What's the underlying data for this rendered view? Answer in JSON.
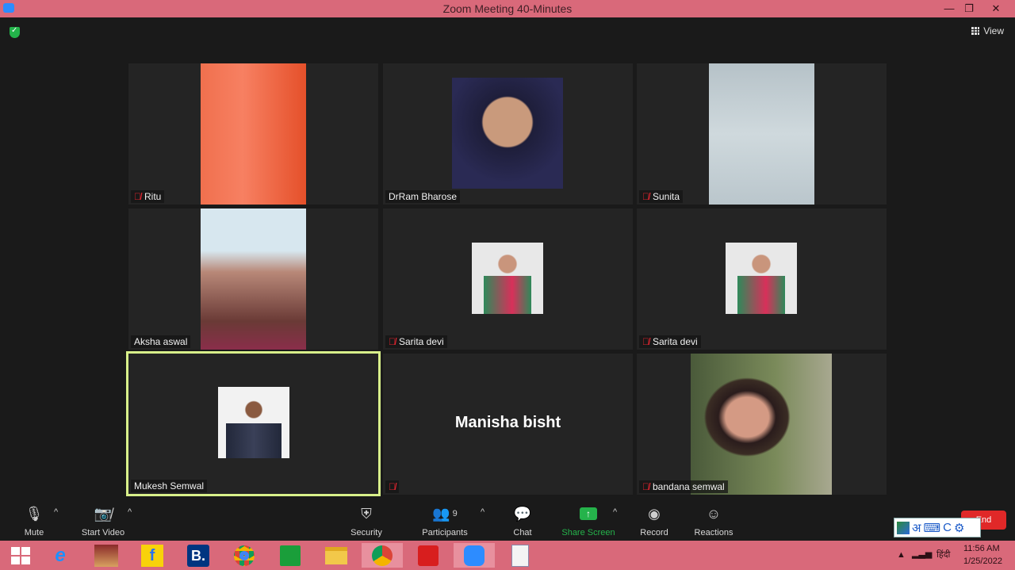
{
  "window": {
    "title": "Zoom Meeting 40-Minutes",
    "min": "—",
    "restore": "❐",
    "close": "✕"
  },
  "view_label": "View",
  "participants_tiles": [
    {
      "name": "Ritu",
      "muted": true
    },
    {
      "name": "DrRam Bharose",
      "muted": false
    },
    {
      "name": "Sunita",
      "muted": true
    },
    {
      "name": "Aksha aswal",
      "muted": false
    },
    {
      "name": "Sarita devi",
      "muted": true
    },
    {
      "name": "Sarita devi",
      "muted": true
    },
    {
      "name": "Mukesh Semwal",
      "muted": false
    },
    {
      "name": "Manisha bisht",
      "muted": true
    },
    {
      "name": "bandana semwal",
      "muted": true
    }
  ],
  "toolbar": {
    "mute": "Mute",
    "start_video": "Start Video",
    "security": "Security",
    "participants": "Participants",
    "participants_count": "9",
    "chat": "Chat",
    "share_screen": "Share Screen",
    "record": "Record",
    "reactions": "Reactions",
    "end": "End"
  },
  "colors": {
    "titlebar": "#d9697a",
    "active_speaker_border": "#d8f08a",
    "share_green": "#25b34b",
    "end_red": "#e02828",
    "muted_red": "#e0242e"
  },
  "ime": {
    "lang_char": "अ",
    "mode": "C"
  },
  "taskbar": {
    "language": "हिंदी",
    "time": "11:56 AM",
    "date": "1/25/2022"
  }
}
